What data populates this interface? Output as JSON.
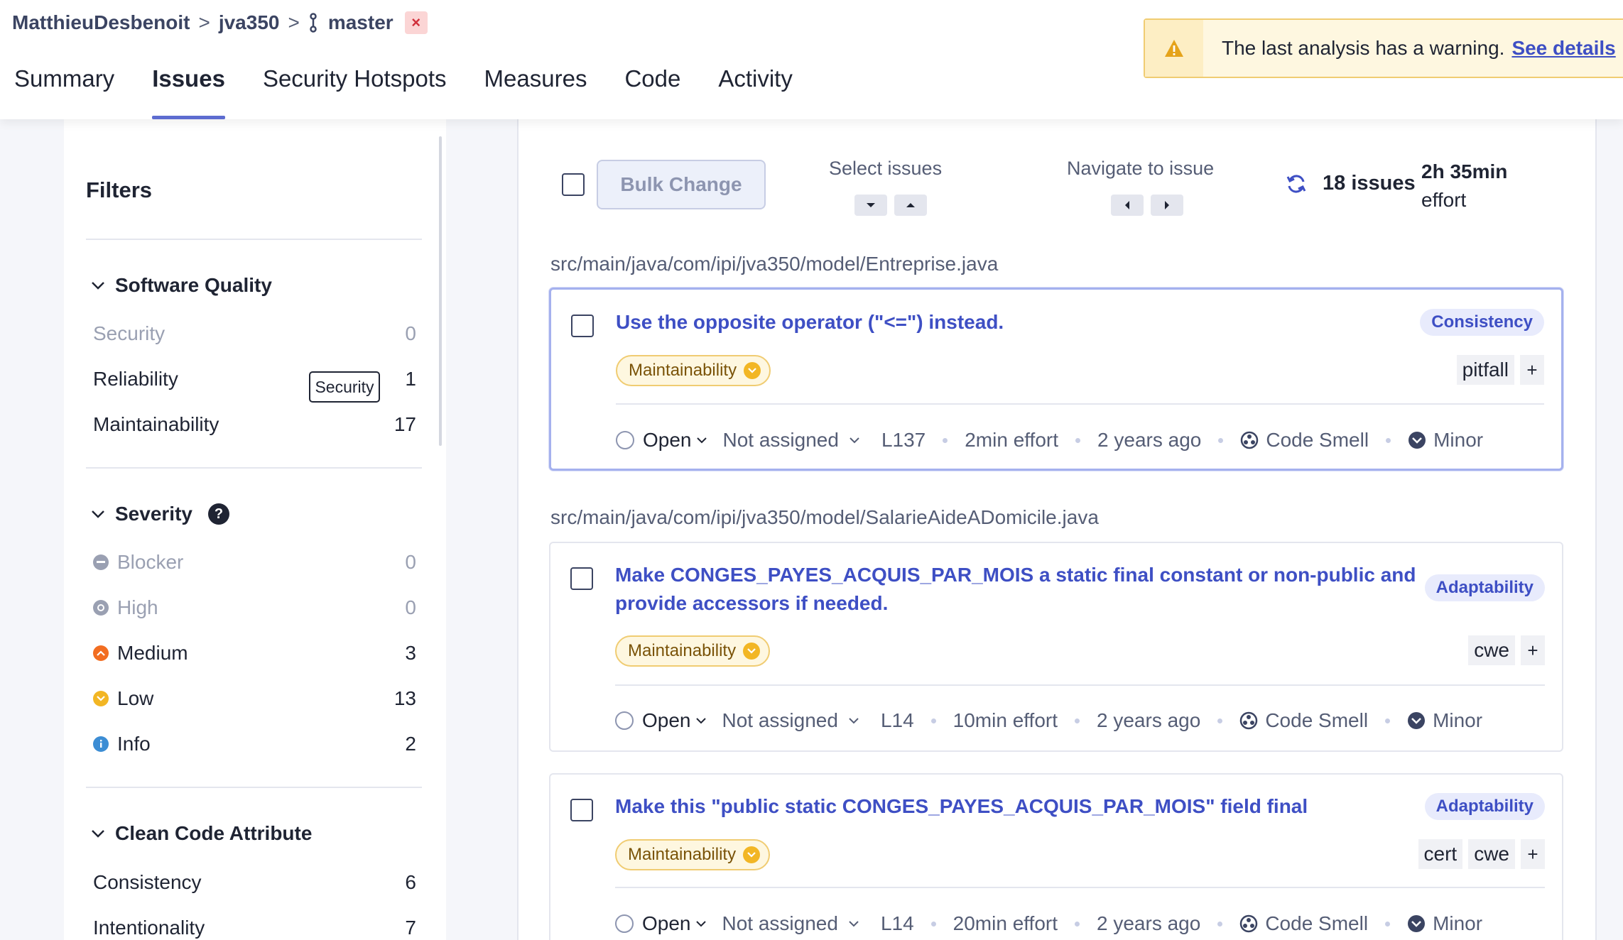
{
  "breadcrumb": {
    "owner": "MatthieuDesbenoit",
    "project": "jva350",
    "branch": "master",
    "separator": ">"
  },
  "tabs": [
    "Summary",
    "Issues",
    "Security Hotspots",
    "Measures",
    "Code",
    "Activity"
  ],
  "active_tab": "Issues",
  "warning": {
    "message": "The last analysis has a warning.",
    "link": "See details"
  },
  "sidebar": {
    "title": "Filters",
    "tooltip": "Security",
    "software_quality": {
      "title": "Software Quality",
      "items": [
        {
          "label": "Security",
          "count": "0"
        },
        {
          "label": "Reliability",
          "count": "1"
        },
        {
          "label": "Maintainability",
          "count": "17"
        }
      ]
    },
    "severity": {
      "title": "Severity",
      "help": "?",
      "items": [
        {
          "label": "Blocker",
          "count": "0",
          "color": "#9aa0b2"
        },
        {
          "label": "High",
          "count": "0",
          "color": "#9aa0b2"
        },
        {
          "label": "Medium",
          "count": "3",
          "color": "#f26d21"
        },
        {
          "label": "Low",
          "count": "13",
          "color": "#f2b624"
        },
        {
          "label": "Info",
          "count": "2",
          "color": "#3c8dd4"
        }
      ]
    },
    "clean_code": {
      "title": "Clean Code Attribute",
      "items": [
        {
          "label": "Consistency",
          "count": "6"
        },
        {
          "label": "Intentionality",
          "count": "7"
        }
      ]
    }
  },
  "toolbar": {
    "bulk_change": "Bulk Change",
    "select_issues": "Select issues",
    "navigate_to_issue": "Navigate to issue",
    "issue_count": "18 issues",
    "effort_value": "2h 35min",
    "effort_label": "effort"
  },
  "files": [
    {
      "path": "src/main/java/com/ipi/jva350/model/Entreprise.java"
    },
    {
      "path": "src/main/java/com/ipi/jva350/model/SalarieAideADomicile.java"
    }
  ],
  "issues": [
    {
      "title": "Use the opposite operator (\"<=\") instead.",
      "attribute": "Consistency",
      "quality": "Maintainability",
      "tags": [
        "pitfall"
      ],
      "status": "Open",
      "assignee": "Not assigned",
      "line": "L137",
      "effort": "2min effort",
      "age": "2 years ago",
      "type": "Code Smell",
      "severity": "Minor"
    },
    {
      "title_line1": "Make CONGES_PAYES_ACQUIS_PAR_MOIS a static final constant or non-public and",
      "title_line2": "provide accessors if needed.",
      "attribute": "Adaptability",
      "quality": "Maintainability",
      "tags": [
        "cwe"
      ],
      "status": "Open",
      "assignee": "Not assigned",
      "line": "L14",
      "effort": "10min effort",
      "age": "2 years ago",
      "type": "Code Smell",
      "severity": "Minor"
    },
    {
      "title": "Make this \"public static CONGES_PAYES_ACQUIS_PAR_MOIS\" field final",
      "attribute": "Adaptability",
      "quality": "Maintainability",
      "tags": [
        "cert",
        "cwe"
      ],
      "status": "Open",
      "assignee": "Not assigned",
      "line": "L14",
      "effort": "20min effort",
      "age": "2 years ago",
      "type": "Code Smell",
      "severity": "Minor"
    }
  ],
  "plus": "+",
  "close_glyph": "×"
}
